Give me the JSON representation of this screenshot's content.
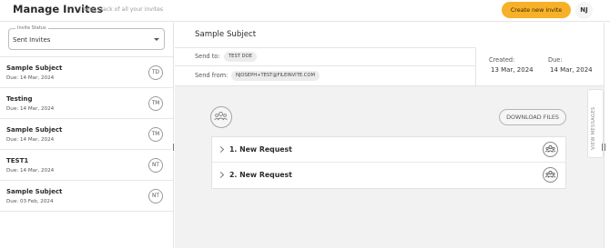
{
  "header": {
    "title": "Manage Invites",
    "subtitle": "| keep track of all your invites",
    "create_button": "Create new invite",
    "user_initials": "NJ"
  },
  "sidebar": {
    "status_label": "Invite Status",
    "status_value": "Sent Invites",
    "invites": [
      {
        "subject": "Sample Subject",
        "due": "Due: 14 Mar, 2024",
        "initials": "TD"
      },
      {
        "subject": "Testing",
        "due": "Due: 14 Mar, 2024",
        "initials": "TM"
      },
      {
        "subject": "Sample Subject",
        "due": "Due: 14 Mar, 2024",
        "initials": "TM"
      },
      {
        "subject": "TEST1",
        "due": "Due: 14 Mar, 2024",
        "initials": "NT"
      },
      {
        "subject": "Sample Subject",
        "due": "Due: 03 Feb, 2024",
        "initials": "NT"
      }
    ]
  },
  "detail": {
    "subject": "Sample Subject",
    "send_to_label": "Send to:",
    "send_to": "TEST DOE",
    "send_from_label": "Send from:",
    "send_from": "NJOSEPH+TEST@FILEINVITE.COM",
    "created_label": "Created:",
    "created": "13 Mar, 2024",
    "due_label": "Due:",
    "due": "14 Mar, 2024",
    "download_button": "DOWNLOAD FILES",
    "requests": [
      {
        "label": "1. New Request"
      },
      {
        "label": "2. New Request"
      }
    ],
    "view_messages": "VIEW MESSAGES"
  },
  "icons": {
    "group": "group-people-icon",
    "chevron": "chevron-right-icon",
    "caret": "caret-down-icon"
  }
}
